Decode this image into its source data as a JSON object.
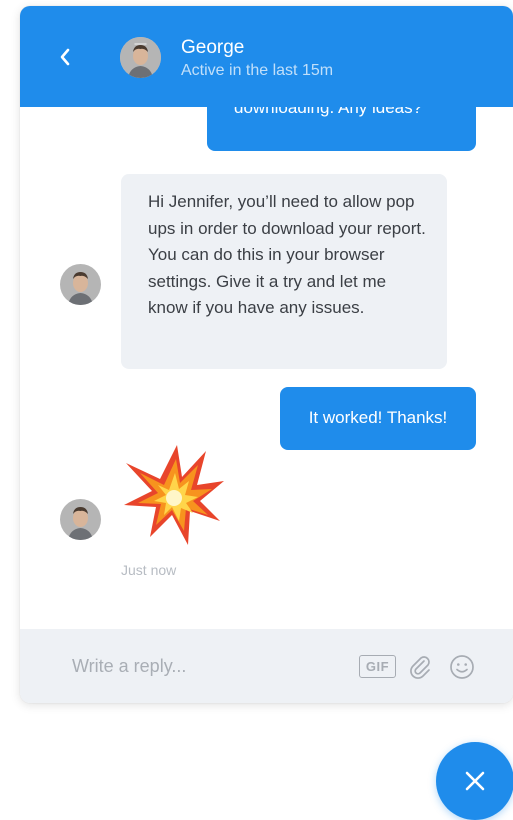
{
  "header": {
    "back_icon": "chevron-left-icon",
    "agent_name": "George",
    "agent_status": "Active in the last 15m",
    "accent_color": "#1f8ceb"
  },
  "messages": [
    {
      "from": "user",
      "text": "downloading. Any ideas?"
    },
    {
      "from": "agent",
      "text": "Hi Jennifer, you’ll need to allow pop ups in order to download your report. You can do this in your browser settings. Give it a try and let me know if you have any issues."
    },
    {
      "from": "user",
      "text": "It worked! Thanks!"
    },
    {
      "from": "agent",
      "emoji": "collision",
      "timestamp": "Just now"
    }
  ],
  "composer": {
    "placeholder": "Write a reply...",
    "gif_label": "GIF",
    "attach_icon": "paperclip-icon",
    "emoji_icon": "smiley-icon"
  },
  "launcher": {
    "icon": "close-icon"
  }
}
